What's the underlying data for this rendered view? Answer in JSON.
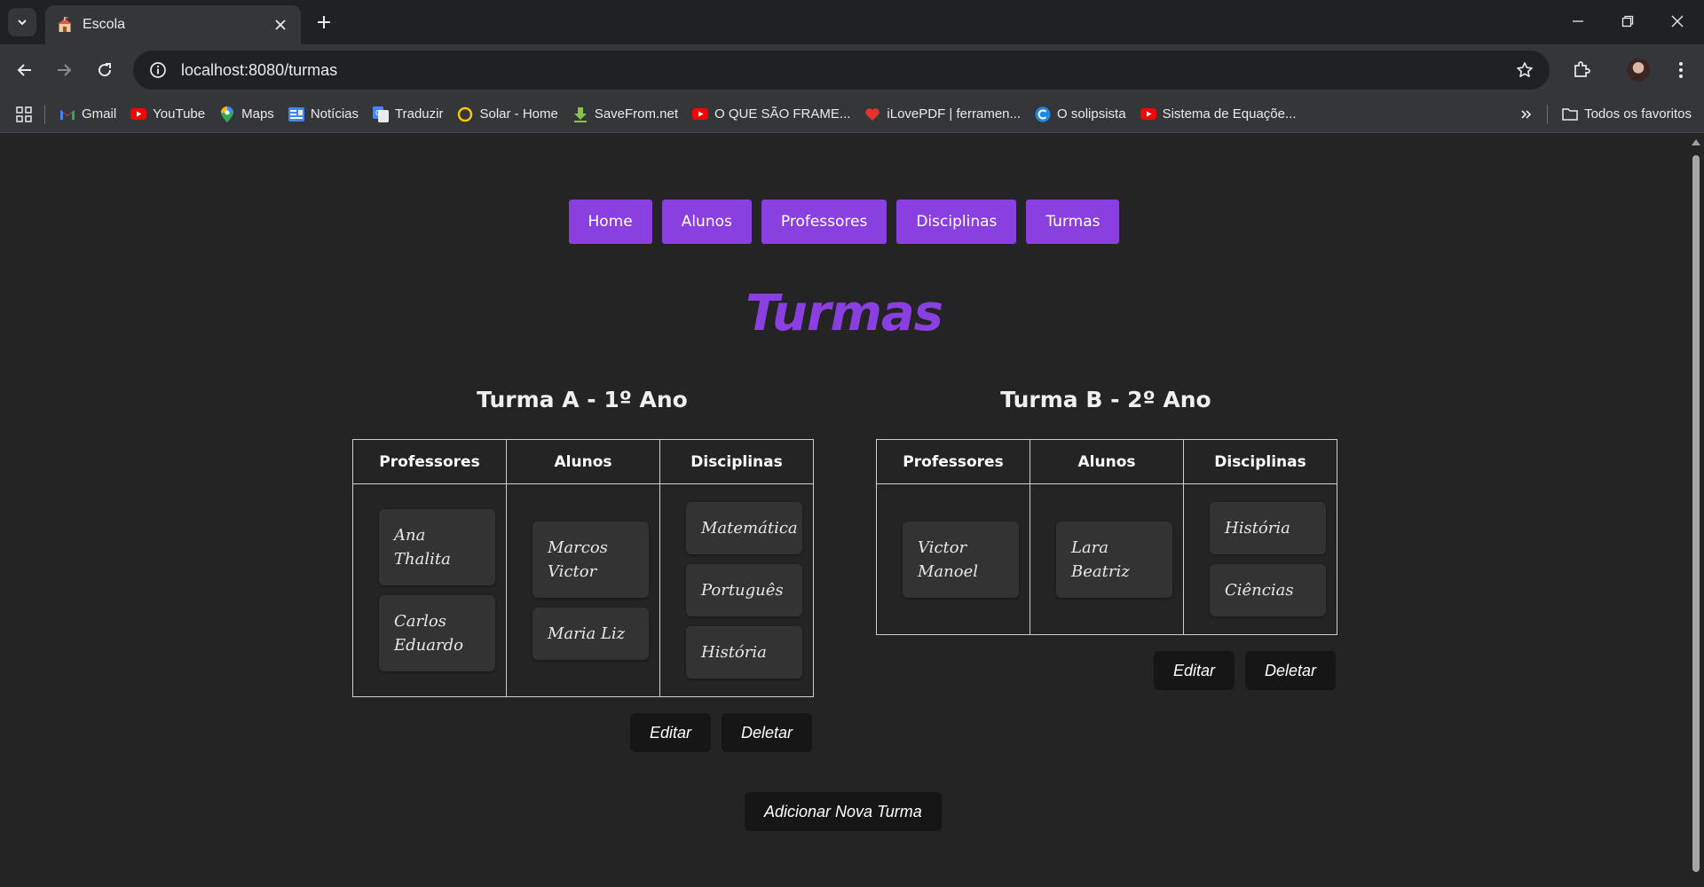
{
  "browser": {
    "tab_title": "Escola",
    "url": "localhost:8080/turmas",
    "bookmarks": [
      {
        "label": "Gmail",
        "icon": "gmail-icon"
      },
      {
        "label": "YouTube",
        "icon": "youtube-icon"
      },
      {
        "label": "Maps",
        "icon": "maps-icon"
      },
      {
        "label": "Notícias",
        "icon": "news-icon"
      },
      {
        "label": "Traduzir",
        "icon": "translate-icon"
      },
      {
        "label": "Solar - Home",
        "icon": "circle-icon"
      },
      {
        "label": "SaveFrom.net",
        "icon": "download-icon"
      },
      {
        "label": "O QUE SÃO FRAME...",
        "icon": "youtube-icon"
      },
      {
        "label": "iLovePDF | ferramen...",
        "icon": "heart-icon"
      },
      {
        "label": "O solipsista",
        "icon": "c-icon"
      },
      {
        "label": "Sistema de Equaçõe...",
        "icon": "youtube-icon"
      }
    ],
    "all_bookmarks_label": "Todos os favoritos",
    "colors": {
      "tabstrip": "#202124",
      "toolbar": "#35363a"
    }
  },
  "nav": {
    "links": [
      "Home",
      "Alunos",
      "Professores",
      "Disciplinas",
      "Turmas"
    ]
  },
  "page": {
    "title": "Turmas",
    "accent_color": "#8a3fe0",
    "turmas": [
      {
        "title": "Turma A - 1º Ano",
        "headers": [
          "Professores",
          "Alunos",
          "Disciplinas"
        ],
        "professores": [
          "Ana Thalita",
          "Carlos Eduardo"
        ],
        "alunos": [
          "Marcos Victor",
          "Maria Liz"
        ],
        "disciplinas": [
          "Matemática",
          "Português",
          "História"
        ],
        "edit_label": "Editar",
        "delete_label": "Deletar"
      },
      {
        "title": "Turma B - 2º Ano",
        "headers": [
          "Professores",
          "Alunos",
          "Disciplinas"
        ],
        "professores": [
          "Victor Manoel"
        ],
        "alunos": [
          "Lara Beatriz"
        ],
        "disciplinas": [
          "História",
          "Ciências"
        ],
        "edit_label": "Editar",
        "delete_label": "Deletar"
      }
    ],
    "add_label": "Adicionar Nova Turma"
  }
}
